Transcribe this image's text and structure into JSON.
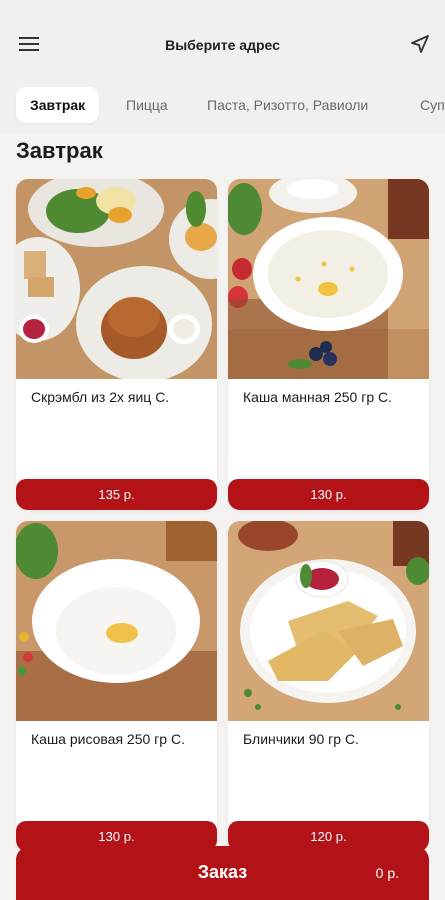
{
  "header": {
    "title": "Выберите адрес"
  },
  "tabs": [
    {
      "label": "Завтрак",
      "active": true
    },
    {
      "label": "Пицца"
    },
    {
      "label": "Паста, Ризотто, Равиоли"
    },
    {
      "label": "Суп"
    }
  ],
  "section": {
    "title": "Завтрак"
  },
  "products": [
    {
      "name": "Скрэмбл из 2х яиц С.",
      "price": "135 р."
    },
    {
      "name": "Каша манная 250 гр С.",
      "price": "130 р."
    },
    {
      "name": "Каша рисовая 250 гр С.",
      "price": "130 р."
    },
    {
      "name": "Блинчики 90 гр С.",
      "price": "120 р."
    }
  ],
  "order": {
    "label": "Заказ",
    "total": "0 р."
  },
  "colors": {
    "accent": "#b31317",
    "background": "#f1f0ee"
  }
}
